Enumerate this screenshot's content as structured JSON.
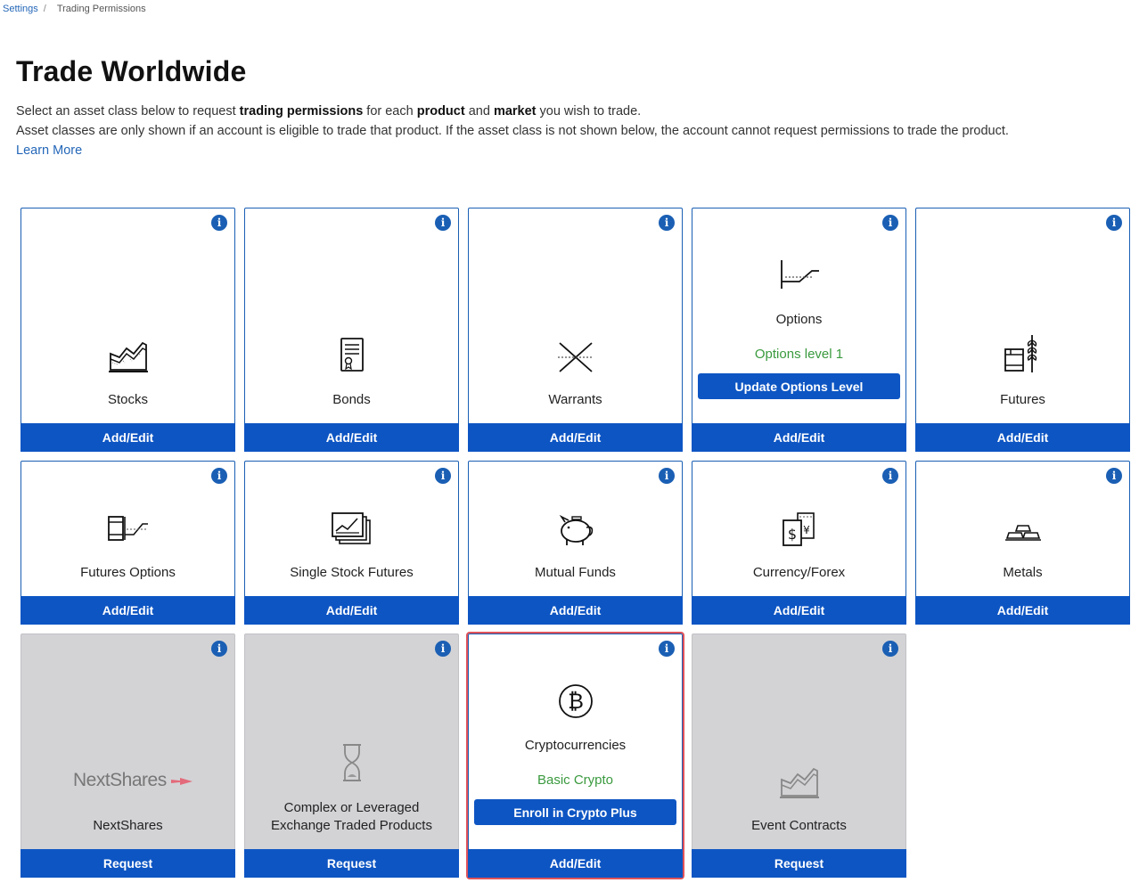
{
  "breadcrumb": {
    "parent": "Settings",
    "separator": "/",
    "current": "Trading Permissions"
  },
  "page_title": "Trade Worldwide",
  "intro": {
    "line1_a": "Select an asset class below to request ",
    "line1_b": "trading permissions",
    "line1_c": " for each ",
    "line1_d": "product",
    "line1_e": " and ",
    "line1_f": "market",
    "line1_g": " you wish to trade.",
    "line2": "Asset classes are only shown if an account is eligible to trade that product. If the asset class is not shown below, the account cannot request permissions to trade the product.",
    "learn_more": "Learn More"
  },
  "info_glyph": "i",
  "cards": {
    "stocks": {
      "label": "Stocks",
      "action": "Add/Edit",
      "icon": "stock-chart-icon"
    },
    "bonds": {
      "label": "Bonds",
      "action": "Add/Edit",
      "icon": "certificate-icon"
    },
    "warrants": {
      "label": "Warrants",
      "action": "Add/Edit",
      "icon": "crossing-lines-icon"
    },
    "options": {
      "label": "Options",
      "status": "Options level 1",
      "inner_button": "Update Options Level",
      "action": "Add/Edit",
      "icon": "options-payoff-icon"
    },
    "futures": {
      "label": "Futures",
      "action": "Add/Edit",
      "icon": "barrel-wheat-icon"
    },
    "futures_options": {
      "label": "Futures Options",
      "action": "Add/Edit",
      "icon": "barrel-payoff-icon"
    },
    "single_stock_futures": {
      "label": "Single Stock Futures",
      "action": "Add/Edit",
      "icon": "stacked-charts-icon"
    },
    "mutual_funds": {
      "label": "Mutual Funds",
      "action": "Add/Edit",
      "icon": "piggy-bank-icon"
    },
    "currency": {
      "label": "Currency/Forex",
      "action": "Add/Edit",
      "icon": "currency-notes-icon"
    },
    "metals": {
      "label": "Metals",
      "action": "Add/Edit",
      "icon": "gold-bars-icon"
    },
    "nextshares": {
      "label": "NextShares",
      "logo_text": "NextShares",
      "action": "Request",
      "icon": "nextshares-logo"
    },
    "complex_etp": {
      "label_line1": "Complex or Leveraged",
      "label_line2": "Exchange Traded Products",
      "action": "Request",
      "icon": "hourglass-icon"
    },
    "crypto": {
      "label": "Cryptocurrencies",
      "status": "Basic Crypto",
      "inner_button": "Enroll in Crypto Plus",
      "action": "Add/Edit",
      "icon": "bitcoin-icon"
    },
    "event_contracts": {
      "label": "Event Contracts",
      "action": "Request",
      "icon": "stock-chart-icon"
    }
  },
  "colors": {
    "primary": "#0d55c3",
    "link": "#2467b8",
    "status_green": "#3a9a3e",
    "disabled_bg": "#d3d3d6",
    "highlight": "#e0535a"
  }
}
